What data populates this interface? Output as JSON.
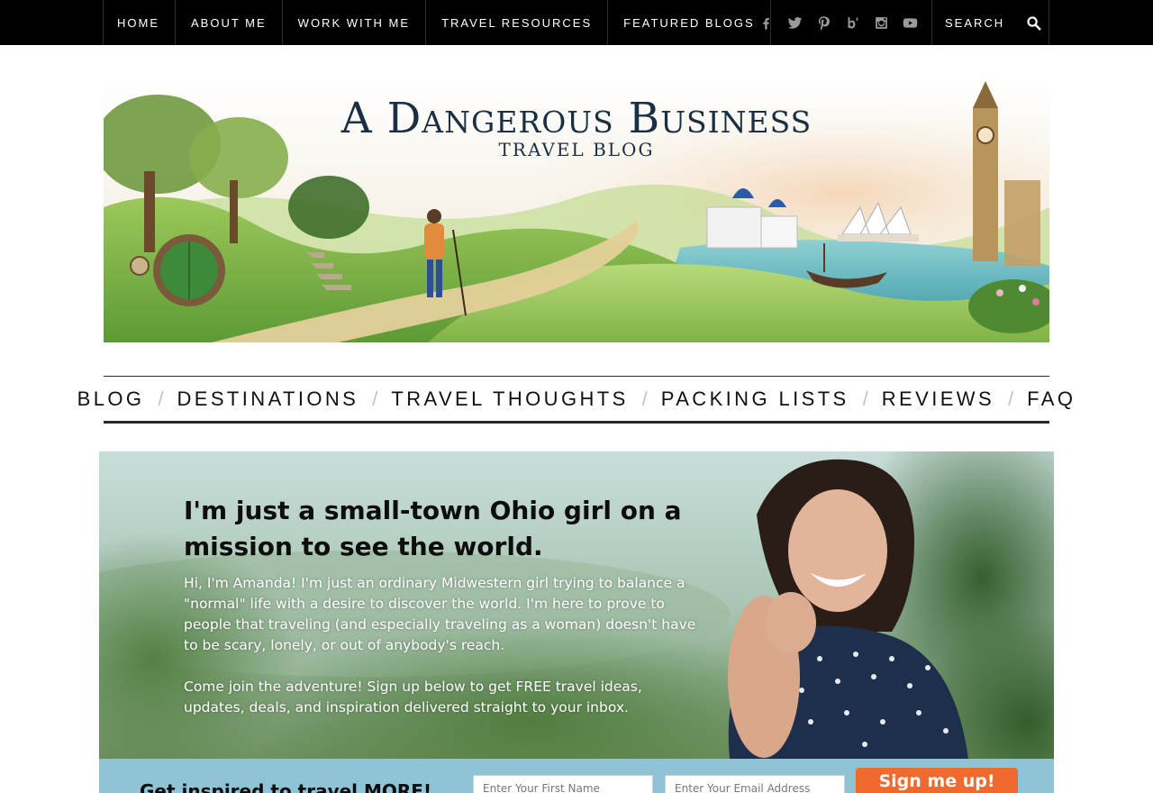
{
  "topnav": {
    "items": [
      {
        "label": "HOME"
      },
      {
        "label": "ABOUT ME"
      },
      {
        "label": "WORK WITH ME"
      },
      {
        "label": "TRAVEL RESOURCES"
      },
      {
        "label": "FEATURED BLOGS"
      }
    ],
    "social_icons": [
      "facebook-icon",
      "twitter-icon",
      "pinterest-icon",
      "bloglovin-icon",
      "instagram-icon",
      "youtube-icon"
    ],
    "search": {
      "placeholder": "SEARCH",
      "icon": "search-icon"
    }
  },
  "header": {
    "title": "A Dangerous Business",
    "subtitle": "TRAVEL BLOG"
  },
  "mainnav": {
    "items": [
      {
        "label": "BLOG"
      },
      {
        "label": "DESTINATIONS"
      },
      {
        "label": "TRAVEL THOUGHTS"
      },
      {
        "label": "PACKING LISTS"
      },
      {
        "label": "REVIEWS"
      },
      {
        "label": "FAQ"
      }
    ],
    "separator": "/"
  },
  "hero": {
    "title": "I'm just a small-town Ohio girl on a mission to see the world.",
    "paragraph1": "Hi, I'm Amanda! I'm just an ordinary Midwestern girl trying to balance a \"normal\" life with a desire to discover the world. I'm here to prove to people that traveling (and especially traveling as a woman) doesn't have to be scary, lonely, or out of anybody's reach.",
    "paragraph2": "Come join the adventure! Sign up below to get FREE travel ideas, updates, deals, and inspiration delivered straight to your inbox."
  },
  "signup": {
    "title": "Get inspired to travel MORE!",
    "first_name_placeholder": "Enter Your First Name",
    "email_placeholder": "Enter Your Email Address",
    "button_label": "Sign me up!"
  },
  "colors": {
    "topbar": "#000000",
    "signup_bar": "#8fc3d6",
    "signup_button": "#ef6a2f",
    "logo_text": "#1a2f43"
  }
}
